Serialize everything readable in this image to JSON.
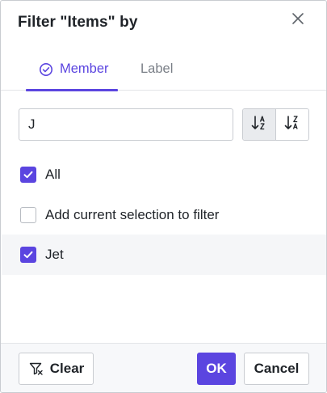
{
  "dialog": {
    "title": "Filter \"Items\" by",
    "close_icon": "close-icon"
  },
  "tabs": [
    {
      "label": "Member",
      "icon": "check-circle-icon",
      "active": true
    },
    {
      "label": "Label",
      "active": false
    }
  ],
  "search": {
    "value": "J"
  },
  "sort": {
    "ascending_icon": "sort-a-z-icon",
    "descending_icon": "sort-z-a-icon",
    "active": "ascending"
  },
  "list": [
    {
      "label": "All",
      "checked": true
    },
    {
      "label": "Add current selection to filter",
      "checked": false
    },
    {
      "label": "Jet",
      "checked": true
    }
  ],
  "footer": {
    "clear_label": "Clear",
    "clear_icon": "clear-filter-icon",
    "ok_label": "OK",
    "cancel_label": "Cancel"
  },
  "colors": {
    "accent": "#5b45e0",
    "muted_text": "#7a7f87",
    "border": "#c9ccd1"
  }
}
